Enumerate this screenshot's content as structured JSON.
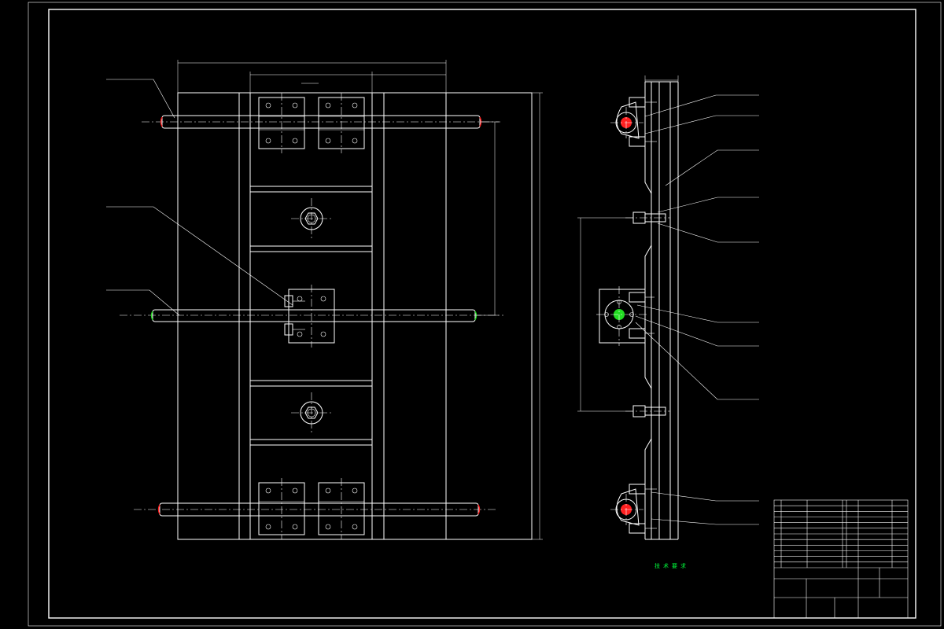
{
  "technical_requirements": {
    "title": "技术要求",
    "lines": []
  },
  "balloons_side_view": [],
  "balloons_front_view": [],
  "colors": {
    "background": "#000000",
    "line": "#ffffff",
    "notes": "#00ff3c",
    "center_mark_red": "#ff2020",
    "center_mark_green": "#22dd22"
  }
}
